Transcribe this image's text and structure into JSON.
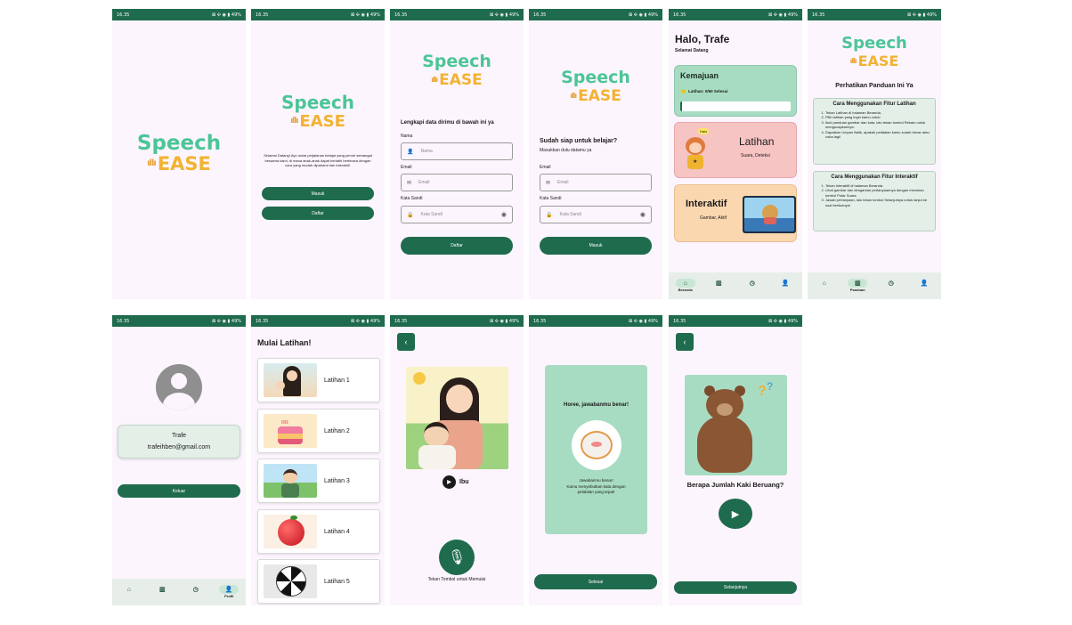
{
  "status_bar": {
    "time": "16.35",
    "icons": "⊠ ✣ ◉ ▮ 49%"
  },
  "logo": {
    "line1": "Speech",
    "line2": "EASE"
  },
  "splash2": {
    "welcome": "Selamat Datang! Ayo mulai perjalanan belajar yang penuh semangat bersama kami, di mana anak-anak dapat berlatih berbicara dengan cara yang mudah dipahami dan interaktif.",
    "login": "Masuk",
    "register": "Daftar"
  },
  "register": {
    "title": "Lengkapi data dirimu di bawah ini ya",
    "name_label": "Nama",
    "name_ph": "Nama",
    "email_label": "Email",
    "email_ph": "Email",
    "pass_label": "Kata Sandi",
    "pass_ph": "Kata Sandi",
    "submit": "Daftar"
  },
  "login": {
    "title": "Sudah siap untuk belajar?",
    "subtitle": "Masukkan dulu datamu ya",
    "email_label": "Email",
    "email_ph": "Email",
    "pass_label": "Kata Sandi",
    "pass_ph": "Kata Sandi",
    "submit": "Masuk"
  },
  "home": {
    "greet": "Halo, Trafe",
    "sub": "Selamat Datang",
    "progress_title": "Kemajuan",
    "progress_text": "Latihan: 0/60 Selesai",
    "progress_value": 0,
    "latihan_title": "Latihan",
    "latihan_sub": "Suara, Deteksi",
    "halo_badge": "Halo",
    "interaktif_title": "Interaktif",
    "interaktif_sub": "Gambar, Aktif"
  },
  "nav": {
    "home": "Beranda",
    "guide": "Panduan",
    "history": "",
    "profile": "Profil"
  },
  "guide": {
    "title": "Perhatikan Panduan Ini Ya",
    "sec1_title": "Cara Menggunakan Fitur Latihan",
    "sec1": [
      "Tekan Latihan di halaman Beranda.",
      "Pilih latihan yang ingin kamu coba!",
      "Ikuti panduan gambar dan kata, lalu tekan tombol Rekam untuk mengucapkannya.",
      "Dapatkan Umpan Balik, apakah pelafalan kamu sudah benar atau coba lagi!"
    ],
    "sec2_title": "Cara Menggunakan Fitur Interaktif",
    "sec2": [
      "Tekan Interaktif di halaman Beranda.",
      "Lihat gambar dan dengarkan pertanyaannya dengan menekan tombol Putar Suara.",
      "Jawab pertanyaan, lalu tekan tombol Selanjutnya untuk lanjut ke soal berikutnya!"
    ]
  },
  "profile": {
    "name": "Trafe",
    "email": "trafeihben@gmail.com",
    "logout": "Keluar"
  },
  "latihan_list": {
    "title": "Mulai Latihan!",
    "items": [
      "Latihan 1",
      "Latihan 2",
      "Latihan 3",
      "Latihan 4",
      "Latihan 5"
    ]
  },
  "practice": {
    "word": "Ibu",
    "hint": "Tekan Tombol untuk Memulai"
  },
  "result": {
    "title": "Horee, jawabanmu benar!",
    "body1": "Jawabanmu benar!",
    "body2": "Kamu menyebutkan kata dengan pelafalan yang tepat!",
    "done": "Selesai"
  },
  "quiz": {
    "question": "Berapa Jumlah Kaki Beruang?",
    "next": "Selanjutnya"
  },
  "colors": {
    "primary": "#1f6b4d",
    "bg": "#fcf5fd",
    "progress_card": "#a8dcc2",
    "latihan_card": "#f7c4c4",
    "interaktif_card": "#fbd7b0"
  }
}
